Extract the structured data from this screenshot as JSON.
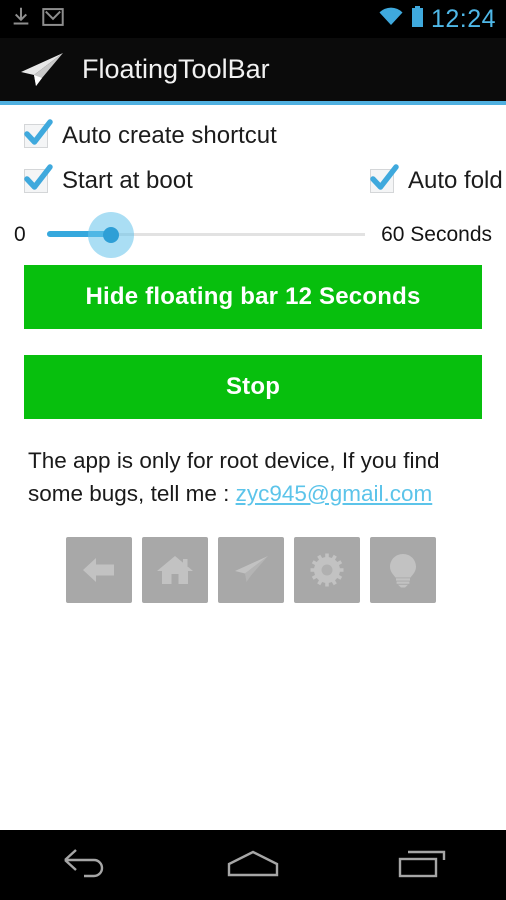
{
  "status_bar": {
    "icons": [
      "download-icon",
      "gmail-icon",
      "wifi-icon",
      "battery-icon"
    ],
    "time": "12:24",
    "time_color": "#4fb8e8",
    "background": "#000000"
  },
  "action_bar": {
    "logo": "paper-plane-logo",
    "title": "FloatingToolBar",
    "background": "#0b0b0b",
    "accent_color": "#4fb0e0"
  },
  "settings": {
    "checkboxes": [
      {
        "label": "Auto create shortcut",
        "checked": true
      },
      {
        "label": "Start at boot",
        "checked": true
      },
      {
        "label": "Auto fold",
        "checked": true
      }
    ],
    "check_color": "#3fa9dd"
  },
  "slider": {
    "min_label": "0",
    "max_label": "60 Seconds",
    "min_value": 0,
    "max_value": 60,
    "current_value": 12,
    "fill_color": "#35a8dd",
    "thumb_color": "#2e9fd6"
  },
  "buttons": {
    "hide_label": "Hide floating bar 12 Seconds",
    "stop_label": "Stop",
    "color": "#07bf0d",
    "text_color": "#ffffff"
  },
  "info": {
    "text": "The app is only for root device, If you find some bugs, tell me : ",
    "email": "zyc945@gmail.com",
    "email_color": "#5cc4ea"
  },
  "toolbar_icons": [
    {
      "name": "back-arrow-icon",
      "label": "Back"
    },
    {
      "name": "home-icon",
      "label": "Home"
    },
    {
      "name": "paper-plane-icon",
      "label": "Send"
    },
    {
      "name": "gear-icon",
      "label": "Settings"
    },
    {
      "name": "lightbulb-icon",
      "label": "Flashlight"
    }
  ],
  "toolbar_icon_background": "#a8a8a8",
  "nav_bar": {
    "buttons": [
      {
        "name": "nav-back-icon",
        "label": "Back"
      },
      {
        "name": "nav-home-icon",
        "label": "Home"
      },
      {
        "name": "nav-recents-icon",
        "label": "Recents"
      }
    ],
    "background": "#000000",
    "icon_color": "#a6a6a6"
  }
}
